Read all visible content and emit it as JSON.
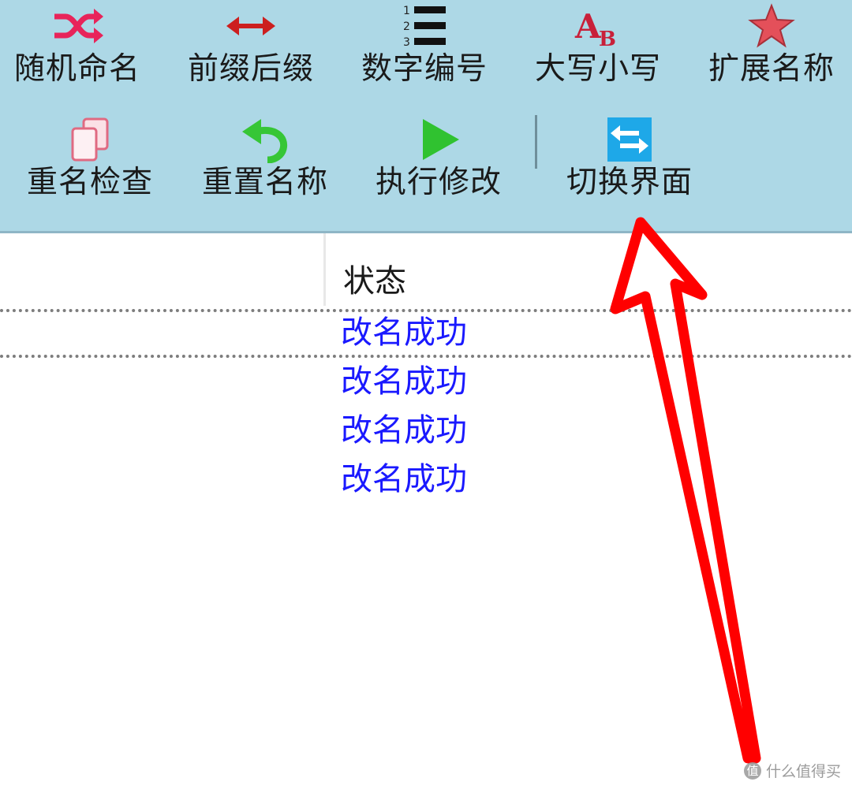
{
  "toolbar": {
    "row1": [
      {
        "label": "随机命名",
        "icon": "shuffle-icon"
      },
      {
        "label": "前缀后缀",
        "icon": "double-arrow-icon"
      },
      {
        "label": "数字编号",
        "icon": "numbered-list-icon"
      },
      {
        "label": "大写小写",
        "icon": "letter-case-icon"
      },
      {
        "label": "扩展名称",
        "icon": "star-icon"
      }
    ],
    "row2": [
      {
        "label": "重名检查",
        "icon": "copy-pages-icon"
      },
      {
        "label": "重置名称",
        "icon": "undo-arrow-icon"
      },
      {
        "label": "执行修改",
        "icon": "play-icon"
      },
      {
        "label": "切换界面",
        "icon": "switch-arrows-icon"
      }
    ]
  },
  "list": {
    "column_header": "状态",
    "rows": [
      "改名成功",
      "改名成功",
      "改名成功",
      "改名成功"
    ]
  },
  "colors": {
    "toolbar_bg": "#add8e6",
    "status_text": "#1a19ff",
    "annotation_arrow": "#ff0000"
  },
  "watermark": {
    "logo": "值",
    "text": "什么值得买"
  }
}
